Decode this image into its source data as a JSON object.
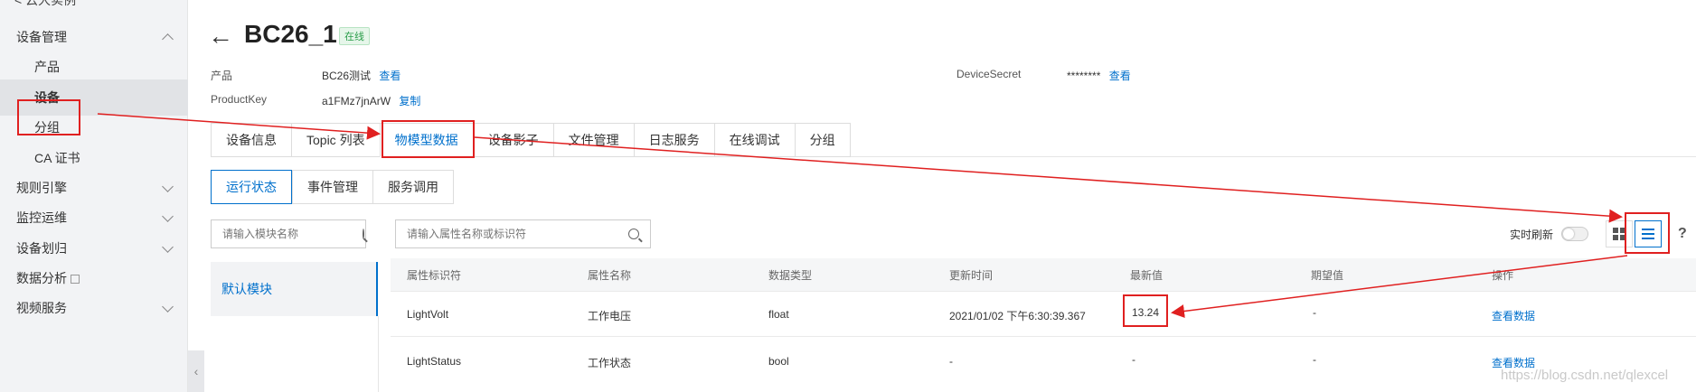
{
  "sidebar": {
    "back_label": "< 云大实例",
    "groups": [
      {
        "label": "设备管理"
      },
      {
        "label": "规则引擎"
      },
      {
        "label": "监控运维"
      },
      {
        "label": "设备划归"
      },
      {
        "label": "数据分析"
      },
      {
        "label": "视频服务"
      }
    ],
    "sub_items": [
      {
        "label": "产品"
      },
      {
        "label": "设备"
      },
      {
        "label": "分组"
      },
      {
        "label": "CA 证书"
      }
    ],
    "collapse_glyph": "‹"
  },
  "header": {
    "back_arrow": "←",
    "title": "BC26_1",
    "status": "在线"
  },
  "info": {
    "product_label": "产品",
    "product_value": "BC26测试",
    "product_link": "查看",
    "productkey_label": "ProductKey",
    "productkey_value": "a1FMz7jnArW",
    "productkey_link": "复制",
    "secret_label": "DeviceSecret",
    "secret_value": "********",
    "secret_link": "查看"
  },
  "tabs": [
    {
      "label": "设备信息"
    },
    {
      "label": "Topic 列表"
    },
    {
      "label": "物模型数据"
    },
    {
      "label": "设备影子"
    },
    {
      "label": "文件管理"
    },
    {
      "label": "日志服务"
    },
    {
      "label": "在线调试"
    },
    {
      "label": "分组"
    }
  ],
  "subtabs": [
    {
      "label": "运行状态"
    },
    {
      "label": "事件管理"
    },
    {
      "label": "服务调用"
    }
  ],
  "module_search": {
    "placeholder": "请输入模块名称"
  },
  "prop_search": {
    "placeholder": "请输入属性名称或标识符"
  },
  "modules": [
    {
      "label": "默认模块"
    }
  ],
  "toolbar": {
    "refresh_label": "实时刷新",
    "help": "?"
  },
  "table": {
    "headers": [
      "属性标识符",
      "属性名称",
      "数据类型",
      "更新时间",
      "最新值",
      "期望值",
      "操作"
    ],
    "rows": [
      [
        "LightVolt",
        "工作电压",
        "float",
        "2021/01/02 下午6:30:39.367",
        "13.24",
        "-",
        "查看数据"
      ],
      [
        "LightStatus",
        "工作状态",
        "bool",
        "-",
        "-",
        "-",
        "查看数据"
      ]
    ]
  },
  "watermark": "https://blog.csdn.net/qlexcel",
  "colors": {
    "accent": "#0070cc",
    "annotation": "#e02020",
    "online": "#2a9d4a"
  }
}
